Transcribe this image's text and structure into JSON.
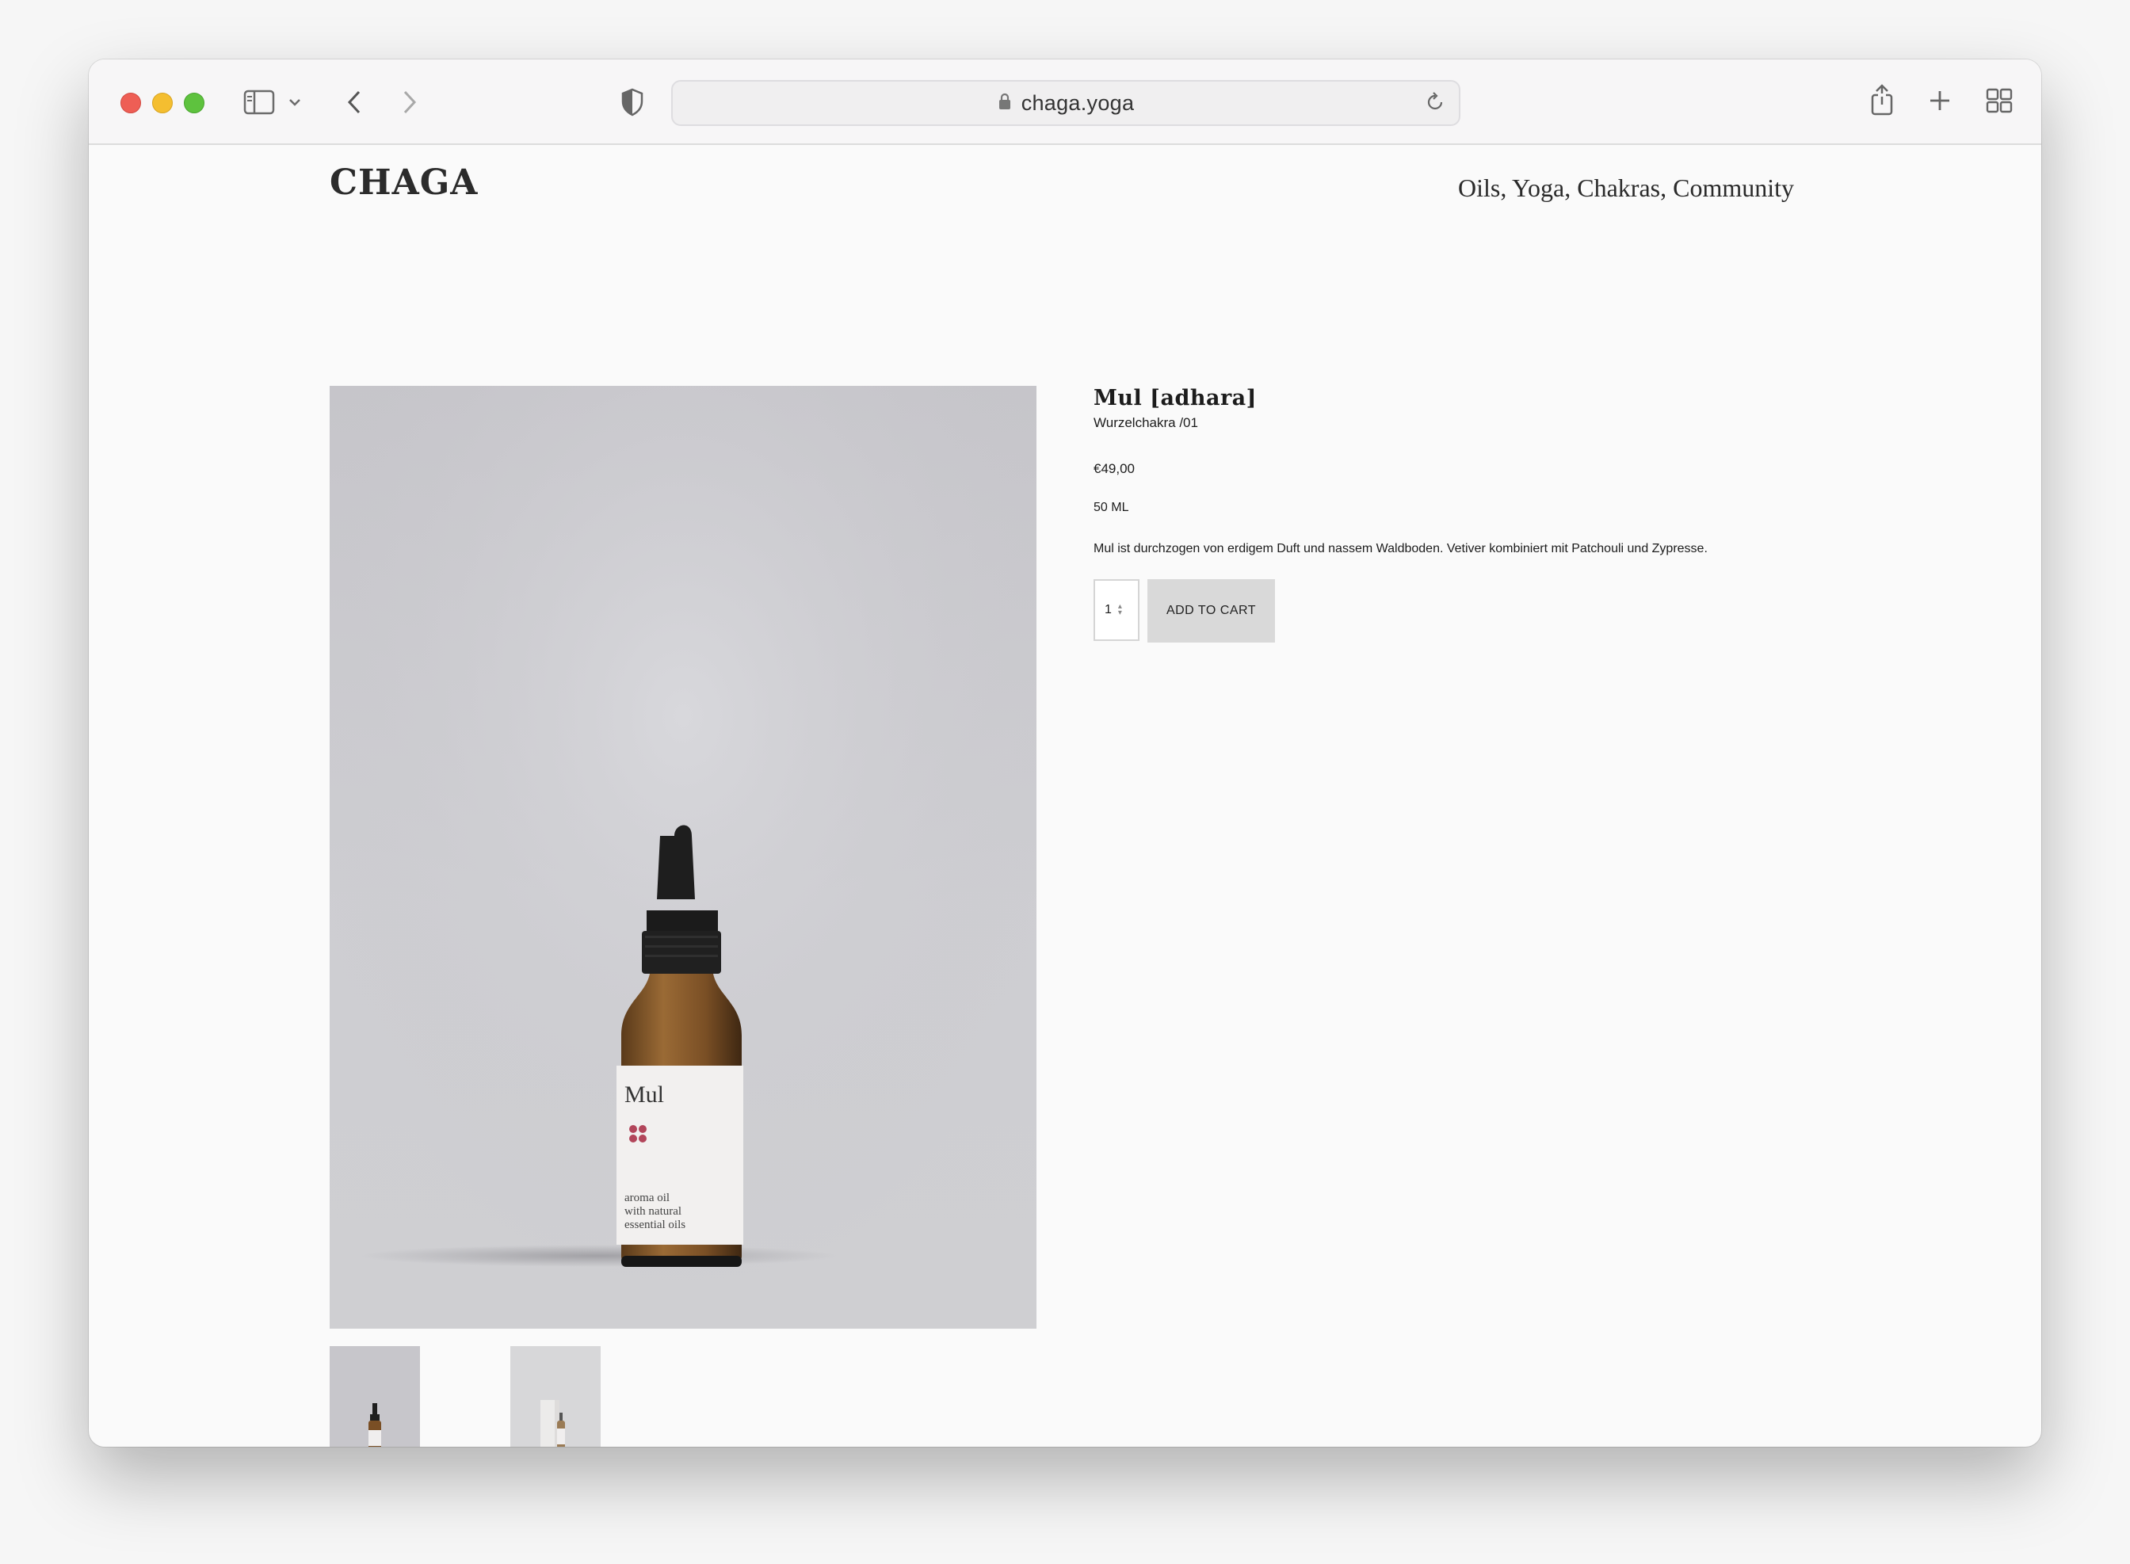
{
  "browser": {
    "url": "chaga.yoga",
    "icons": [
      "sidebar-icon",
      "chevron-down-icon",
      "back-icon",
      "forward-icon",
      "shield-icon",
      "lock-icon",
      "reload-icon",
      "share-icon",
      "plus-icon",
      "tabs-icon"
    ]
  },
  "site": {
    "logo": "CHAGA",
    "nav": [
      "Oils",
      "Yoga",
      "Chakras",
      "Community"
    ]
  },
  "product": {
    "title": "Mul [adhara]",
    "subtitle": "Wurzelchakra /01",
    "price": "€49,00",
    "size": "50 ML",
    "description": "Mul ist durchzogen von erdigem Duft und nassem Waldboden. Vetiver kombiniert mit Patchouli und Zypresse.",
    "quantity": "1",
    "add_to_cart": "ADD TO CART",
    "label": {
      "name": "Mul",
      "line1": "aroma oil",
      "line2": "with natural",
      "line3": "essential oils"
    }
  },
  "colors": {
    "traffic_red": "#ee5e55",
    "traffic_yellow": "#f4be30",
    "traffic_green": "#5ec23e",
    "button_bg": "#d9d9d9",
    "label_symbol": "#b2455a"
  }
}
